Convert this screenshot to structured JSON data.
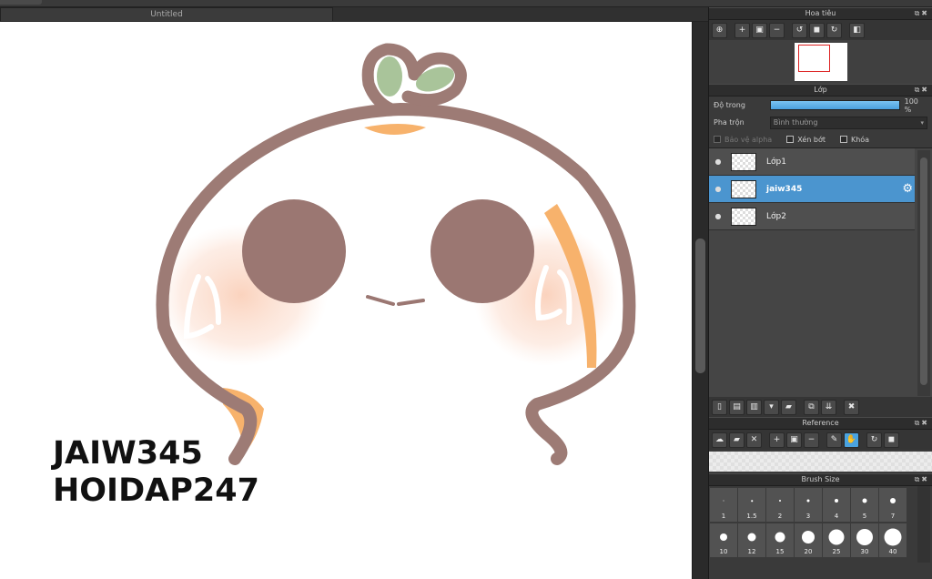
{
  "document": {
    "tab_title": "Untitled"
  },
  "navigator": {
    "title": "Hoa tiêu",
    "tools": [
      "zoom-fit-icon",
      "zoom-in-icon",
      "fit-icon",
      "zoom-out-icon",
      "rotate-left-icon",
      "fullscreen-icon",
      "rotate-right-icon",
      "flip-icon"
    ]
  },
  "layers": {
    "title": "Lớp",
    "opacity_label": "Độ trong",
    "opacity_value": "100 %",
    "opacity_fraction": 1.0,
    "blend_label": "Pha trộn",
    "blend_value": "Bình thường",
    "protect_alpha": "Bảo vệ alpha",
    "clipping": "Xén bớt",
    "lock": "Khóa",
    "items": [
      {
        "name": "Lớp1",
        "selected": false
      },
      {
        "name": "jaiw345",
        "selected": true
      },
      {
        "name": "Lớp2",
        "selected": false
      }
    ]
  },
  "reference": {
    "title": "Reference"
  },
  "brush_size": {
    "title": "Brush Size",
    "row1": [
      "1",
      "1.5",
      "2",
      "3",
      "4",
      "5",
      "7"
    ],
    "row2": [
      "10",
      "12",
      "15",
      "20",
      "25",
      "30",
      "40"
    ]
  },
  "canvas": {
    "text_line1": "JAIW345",
    "text_line2": "HOIDAP247"
  },
  "colors": {
    "outline": "#9d7b75",
    "eye": "#9b7772",
    "leaf": "#a9c49a",
    "orange": "#f7b26c",
    "blush": "#fbd6c3",
    "selected_layer": "#4b95cf"
  }
}
